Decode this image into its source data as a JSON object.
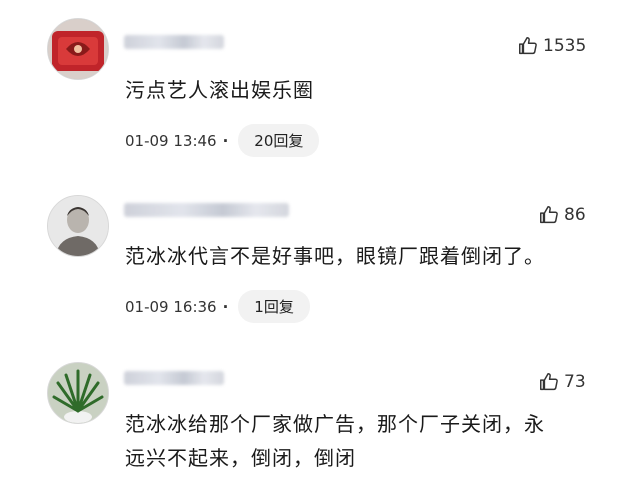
{
  "comments": [
    {
      "like_count": "1535",
      "text": "污点艺人滚出娱乐圈",
      "timestamp": "01-09 13:46",
      "reply_label": "20回复"
    },
    {
      "like_count": "86",
      "text": "范冰冰代言不是好事吧，眼镜厂跟着倒闭了。",
      "timestamp": "01-09 16:36",
      "reply_label": "1回复"
    },
    {
      "like_count": "73",
      "text_line1": "范冰冰给那个厂家做广告，那个厂子关闭，永",
      "text_line2": "远兴不起来，倒闭，倒闭"
    }
  ],
  "separator": "·",
  "colors": {
    "reply_bg": "#f2f2f2",
    "text": "#1a1a1a",
    "meta": "#333333"
  }
}
